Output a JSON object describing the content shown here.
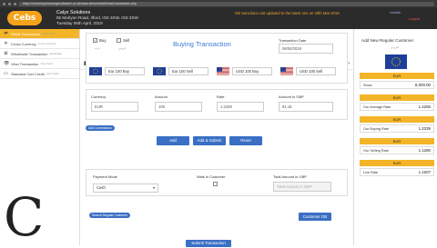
{
  "browser": {
    "url": "https://currencyexchangesoftware.co.uk/www.demo/retail/retail-transaction.php"
  },
  "header": {
    "logo_text": "Cebs",
    "company_name": "Calyx Solutions",
    "company_address": "85 Marlyon Road, Ilford, IG6 3XW, IG6 3XW",
    "date": "Tuesday 06th April, 2019",
    "notice": "GB Sanctions List updated to the latest one on 29th Mar 2019",
    "user": "visitalk",
    "user_sub": "logout",
    "logout": "Logout"
  },
  "sidebar": {
    "items": [
      {
        "label": "Dashboard",
        "sub": "dashboards",
        "icon": "dashboard-icon",
        "main": true
      },
      {
        "label": "Retail",
        "sub": "retail",
        "icon": "retail-icon",
        "main": true
      },
      {
        "label": "Retail Transaction",
        "sub": "retail trans",
        "icon": "transaction-icon",
        "active": true
      },
      {
        "label": "Cross Currency",
        "sub": "cross currency",
        "icon": "cross-icon"
      },
      {
        "label": "Wholesale Transaction",
        "sub": "wholesale",
        "icon": "wholesale-icon"
      },
      {
        "label": "View Transaction",
        "sub": "view trans",
        "icon": "view-icon"
      },
      {
        "label": "Standard Cart Credit",
        "sub": "card credit",
        "icon": "card-icon"
      },
      {
        "label": "Customer Order",
        "sub": "",
        "icon": "order-icon",
        "main": true
      },
      {
        "label": "Stock",
        "sub": "stock mgmt",
        "icon": "stock-icon",
        "main": true
      },
      {
        "label": "Target",
        "sub": "target",
        "icon": "target-icon",
        "main": true
      }
    ]
  },
  "form": {
    "buy_label": "Buy",
    "sell_label": "Sell",
    "title": "Buying Transaction",
    "buy_sub": "خرید",
    "sell_sub": "فروش",
    "tx_date_label": "Transaction Date",
    "tx_date_value": "06/04/2019",
    "quick": [
      {
        "label": "Eur 100 Buy",
        "flag": "eu"
      },
      {
        "label": "Eur 100 Sell",
        "flag": "eu"
      },
      {
        "label": "USD 100 Buy",
        "flag": "us"
      },
      {
        "label": "USD 100 Sell",
        "flag": "us"
      }
    ],
    "currency_label": "Currency",
    "currency_value": "EUR",
    "amount_label": "Amount",
    "amount_value": "100",
    "rate_label": "Rate",
    "rate_value": "1.2339",
    "gbp_label": "Amount In GBP",
    "gbp_value": "81.16",
    "add_commission": "Add Commission",
    "add_btn": "Add",
    "add_submit_btn": "Add & Submit",
    "reset_btn": "Reset",
    "payment_mode_label": "Payment Mode",
    "payment_mode_value": "Cash",
    "walk_in_label": "Walk in Customer",
    "total_gbp_label": "Total Amount in GBP",
    "total_gbp_placeholder": "Total Amount in GBP",
    "search_customer": "Search Regular Customer",
    "customer_db": "Customer DB",
    "submit": "Submit Transaction"
  },
  "rightpanel": {
    "title": "Add New Regular Customer",
    "sub": "افزودن",
    "currency": "EUR",
    "rows": [
      {
        "badge": "EUR",
        "label": "Stock",
        "value": "8,000.00"
      },
      {
        "badge": "EUR",
        "label": "Our Average Rate",
        "value": "1.2256"
      },
      {
        "badge": "EUR",
        "label": "Our Buying Rate",
        "value": "1.2339"
      },
      {
        "badge": "EUR",
        "label": "Our Selling Rate",
        "value": "1.1280"
      },
      {
        "badge": "EUR",
        "label": "Live Rate",
        "value": "1.1607"
      }
    ]
  }
}
